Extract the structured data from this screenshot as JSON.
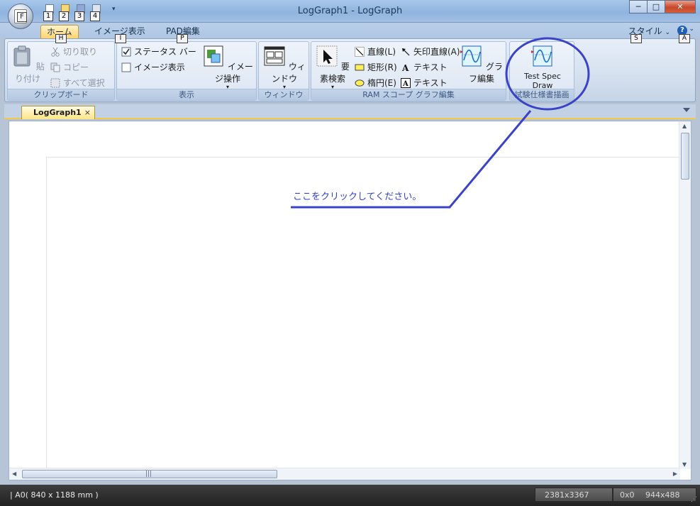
{
  "window": {
    "title": "LogGraph1 - LogGraph",
    "minimize": "─",
    "maximize": "□",
    "close": "✕"
  },
  "app_button": {
    "keytip": "F"
  },
  "quick_access": {
    "keytips": [
      "1",
      "2",
      "3",
      "4"
    ]
  },
  "ribbon_tabs": [
    {
      "label": "ホーム",
      "keytip": "H"
    },
    {
      "label": "イメージ表示",
      "keytip": "I"
    },
    {
      "label": "PAD編集",
      "keytip": "P"
    }
  ],
  "ribbon_right": {
    "style_label": "スタイル",
    "style_keytip": "S",
    "help_keytip": "A",
    "help_glyph": "?"
  },
  "groups": {
    "clipboard": {
      "label": "クリップボード",
      "paste": "貼り付け",
      "cut": "切り取り",
      "copy": "コピー",
      "select_all": "すべて選択"
    },
    "display": {
      "label": "表示",
      "status_bar": "ステータス バー",
      "image_display": "イメージ表示",
      "image_ops": "イメージ操作"
    },
    "window": {
      "label": "ウィンドウ",
      "window_button": "ウィンドウ"
    },
    "ram_scope": {
      "label": "RAM スコープ グラフ編集",
      "element_search": "要素検索",
      "line": "直線(L)",
      "rect": "矩形(R)",
      "ellipse": "楕円(E)",
      "arrow_line": "矢印直線(A)",
      "text1": "テキスト",
      "text2": "テキスト",
      "graph_edit": "グラフ編集"
    },
    "test_spec": {
      "label": "試験仕様書描画",
      "button_line1": "Test Spec",
      "button_line2": "Draw"
    }
  },
  "document": {
    "tab_label": "LogGraph1",
    "tab_close": "×"
  },
  "annotation": {
    "text": "ここをクリックしてください。",
    "color": "#3a43c8"
  },
  "statusbar": {
    "paper": "|  A0( 840 x 1188 mm )",
    "size": "2381x3367",
    "pos": "0x0",
    "view": "944x488"
  }
}
